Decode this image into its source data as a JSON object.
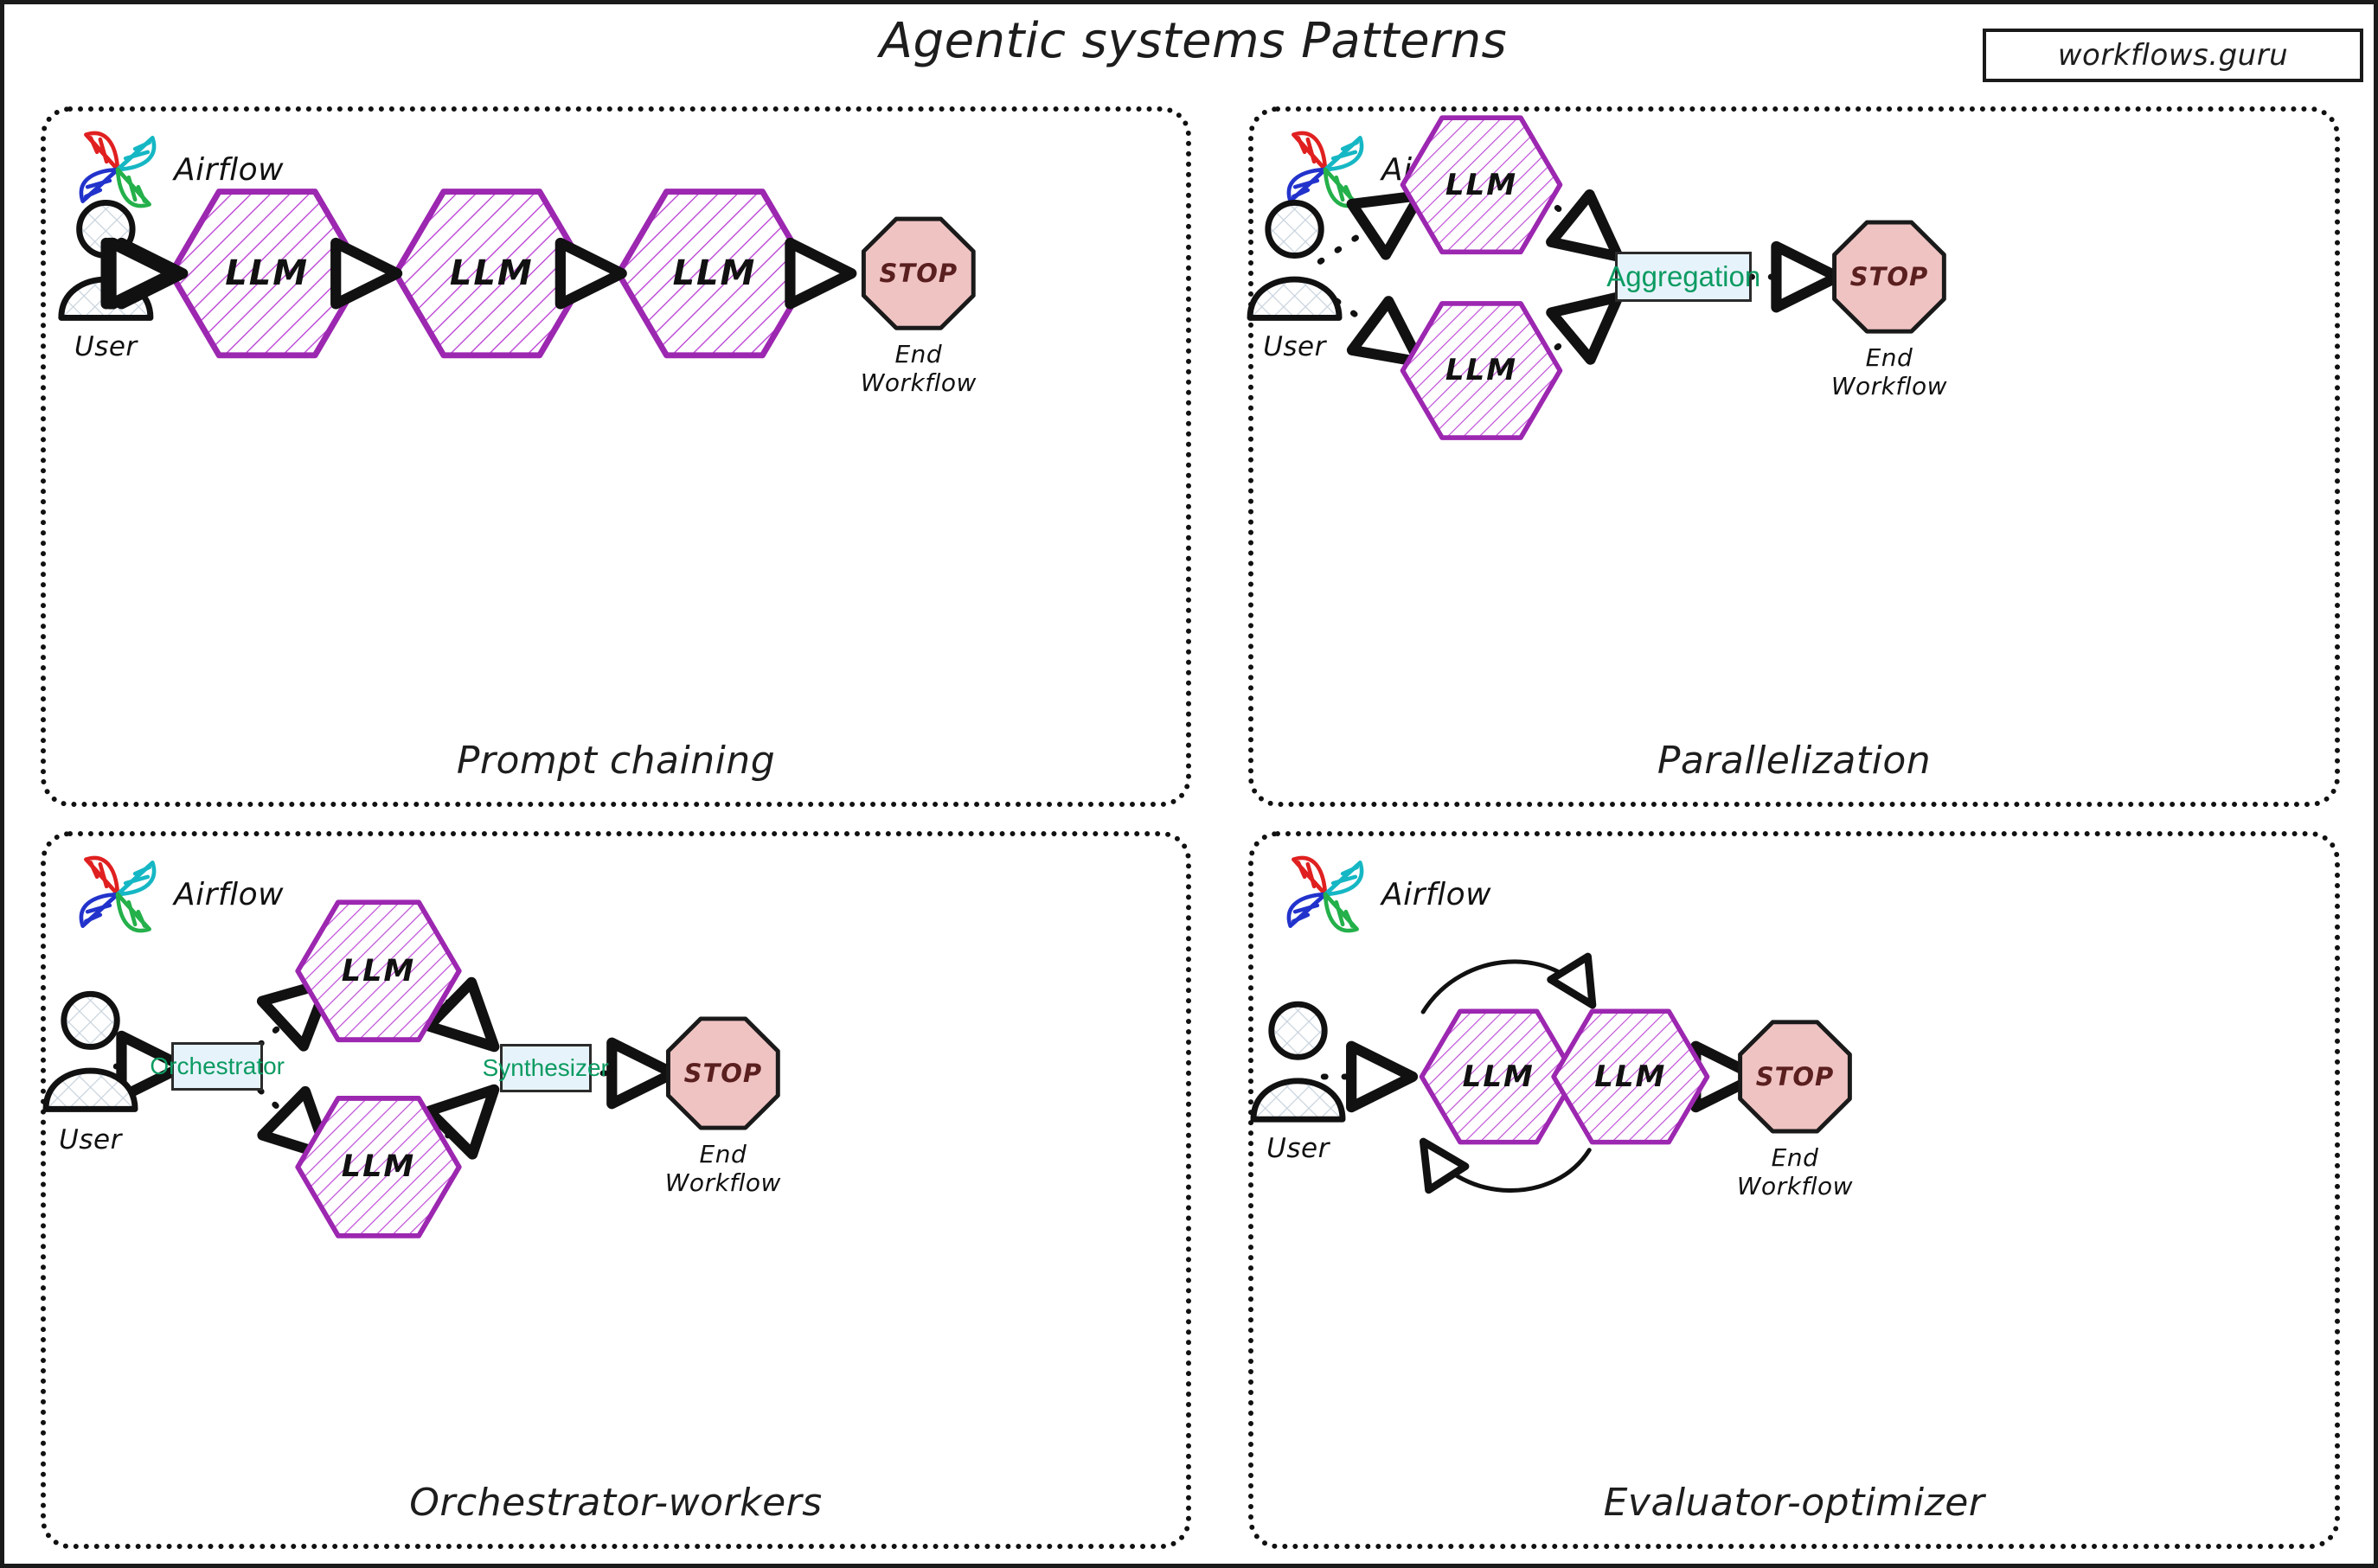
{
  "header": {
    "title": "Agentic systems Patterns",
    "watermark": "workflows.guru"
  },
  "common": {
    "airflow_label": "Airflow",
    "user_label": "User",
    "llm_label": "LLM",
    "stop_label": "STOP",
    "end_workflow_label": "End\nWorkflow",
    "end_line1": "End",
    "end_line2": "Workflow"
  },
  "colors": {
    "llm_stroke": "#9c27b0",
    "llm_hatch": "#c050d8",
    "stop_fill": "#f0c3c3",
    "stop_stroke": "#1a1a1a",
    "stop_text": "#5a1f1f",
    "box_fill": "#e7f3fb",
    "box_border": "#2b2b2b",
    "box_text": "#0c9b62",
    "arrow": "#111111",
    "panel_border": "#111111",
    "airflow_red": "#e02020",
    "airflow_cyan": "#16b7c4",
    "airflow_blue": "#2233cc",
    "airflow_green": "#24b04a"
  },
  "panels": [
    {
      "id": "prompt-chaining",
      "title": "Prompt chaining",
      "airflow": "Airflow",
      "nodes": [
        {
          "type": "user",
          "label": "User"
        },
        {
          "type": "llm",
          "label": "LLM"
        },
        {
          "type": "llm",
          "label": "LLM"
        },
        {
          "type": "llm",
          "label": "LLM"
        },
        {
          "type": "stop",
          "label": "STOP",
          "caption": "End Workflow"
        }
      ],
      "edges": [
        {
          "from": "User",
          "to": "LLM",
          "style": "dotted"
        },
        {
          "from": "LLM",
          "to": "LLM",
          "style": "dotted"
        },
        {
          "from": "LLM",
          "to": "LLM",
          "style": "dotted"
        },
        {
          "from": "LLM",
          "to": "STOP",
          "style": "dotted"
        }
      ]
    },
    {
      "id": "parallelization",
      "title": "Parallelization",
      "airflow": "Airflow",
      "nodes": [
        {
          "type": "user",
          "label": "User"
        },
        {
          "type": "llm",
          "label": "LLM"
        },
        {
          "type": "llm",
          "label": "LLM"
        },
        {
          "type": "box",
          "label": "Aggregation"
        },
        {
          "type": "stop",
          "label": "STOP",
          "caption": "End Workflow"
        }
      ],
      "edges": [
        {
          "from": "User",
          "to": "LLM (top)",
          "style": "dotted"
        },
        {
          "from": "User",
          "to": "LLM (bottom)",
          "style": "dotted"
        },
        {
          "from": "LLM (top)",
          "to": "Aggregation",
          "style": "dotted"
        },
        {
          "from": "LLM (bottom)",
          "to": "Aggregation",
          "style": "dotted"
        },
        {
          "from": "Aggregation",
          "to": "STOP",
          "style": "dotted"
        }
      ]
    },
    {
      "id": "orchestrator-workers",
      "title": "Orchestrator-workers",
      "airflow": "Airflow",
      "nodes": [
        {
          "type": "user",
          "label": "User"
        },
        {
          "type": "box",
          "label": "Orchestrator"
        },
        {
          "type": "llm",
          "label": "LLM"
        },
        {
          "type": "llm",
          "label": "LLM"
        },
        {
          "type": "box",
          "label": "Synthesizer"
        },
        {
          "type": "stop",
          "label": "STOP",
          "caption": "End Workflow"
        }
      ],
      "edges": [
        {
          "from": "User",
          "to": "Orchestrator",
          "style": "dotted"
        },
        {
          "from": "Orchestrator",
          "to": "LLM (top)",
          "style": "dotted"
        },
        {
          "from": "Orchestrator",
          "to": "LLM (bottom)",
          "style": "dotted"
        },
        {
          "from": "LLM (top)",
          "to": "Synthesizer",
          "style": "dotted"
        },
        {
          "from": "LLM (bottom)",
          "to": "Synthesizer",
          "style": "dotted"
        },
        {
          "from": "Synthesizer",
          "to": "STOP",
          "style": "dotted"
        }
      ]
    },
    {
      "id": "evaluator-optimizer",
      "title": "Evaluator-optimizer",
      "airflow": "Airflow",
      "nodes": [
        {
          "type": "user",
          "label": "User"
        },
        {
          "type": "llm",
          "label": "LLM"
        },
        {
          "type": "llm",
          "label": "LLM"
        },
        {
          "type": "stop",
          "label": "STOP",
          "caption": "End Workflow"
        }
      ],
      "edges": [
        {
          "from": "User",
          "to": "LLM (left)",
          "style": "dotted"
        },
        {
          "from": "LLM (left)",
          "to": "LLM (right)",
          "style": "curved-solid"
        },
        {
          "from": "LLM (right)",
          "to": "LLM (left)",
          "style": "curved-solid"
        },
        {
          "from": "LLM (right)",
          "to": "STOP",
          "style": "dotted"
        }
      ]
    }
  ]
}
